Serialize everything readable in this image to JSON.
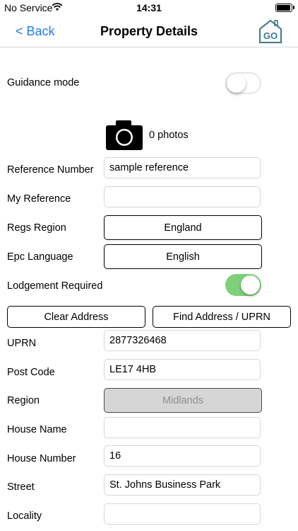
{
  "status_bar": {
    "carrier": "No Service",
    "time": "14:31"
  },
  "nav": {
    "back_label": "< Back",
    "title": "Property Details",
    "logo_text": "GO"
  },
  "guidance": {
    "label": "Guidance mode",
    "on": false
  },
  "camera": {
    "photos_label": "0 photos"
  },
  "fields": {
    "reference_number": {
      "label": "Reference Number",
      "value": "sample reference"
    },
    "my_reference": {
      "label": "My Reference",
      "value": ""
    },
    "regs_region": {
      "label": "Regs Region",
      "value": "England"
    },
    "epc_language": {
      "label": "Epc Language",
      "value": "English"
    },
    "lodgement": {
      "label": "Lodgement Required",
      "on": true
    },
    "uprn": {
      "label": "UPRN",
      "value": "2877326468"
    },
    "post_code": {
      "label": "Post Code",
      "value": "LE17 4HB"
    },
    "region": {
      "label": "Region",
      "value": "Midlands"
    },
    "house_name": {
      "label": "House Name",
      "value": ""
    },
    "house_number": {
      "label": "House Number",
      "value": "16"
    },
    "street": {
      "label": "Street",
      "value": "St. Johns Business Park"
    },
    "locality": {
      "label": "Locality",
      "value": ""
    }
  },
  "buttons": {
    "clear_address": "Clear Address",
    "find_address": "Find Address / UPRN"
  },
  "colors": {
    "link": "#1f7cf6",
    "toggle_on": "#7ed07a",
    "logo": "#3a7a8c"
  }
}
